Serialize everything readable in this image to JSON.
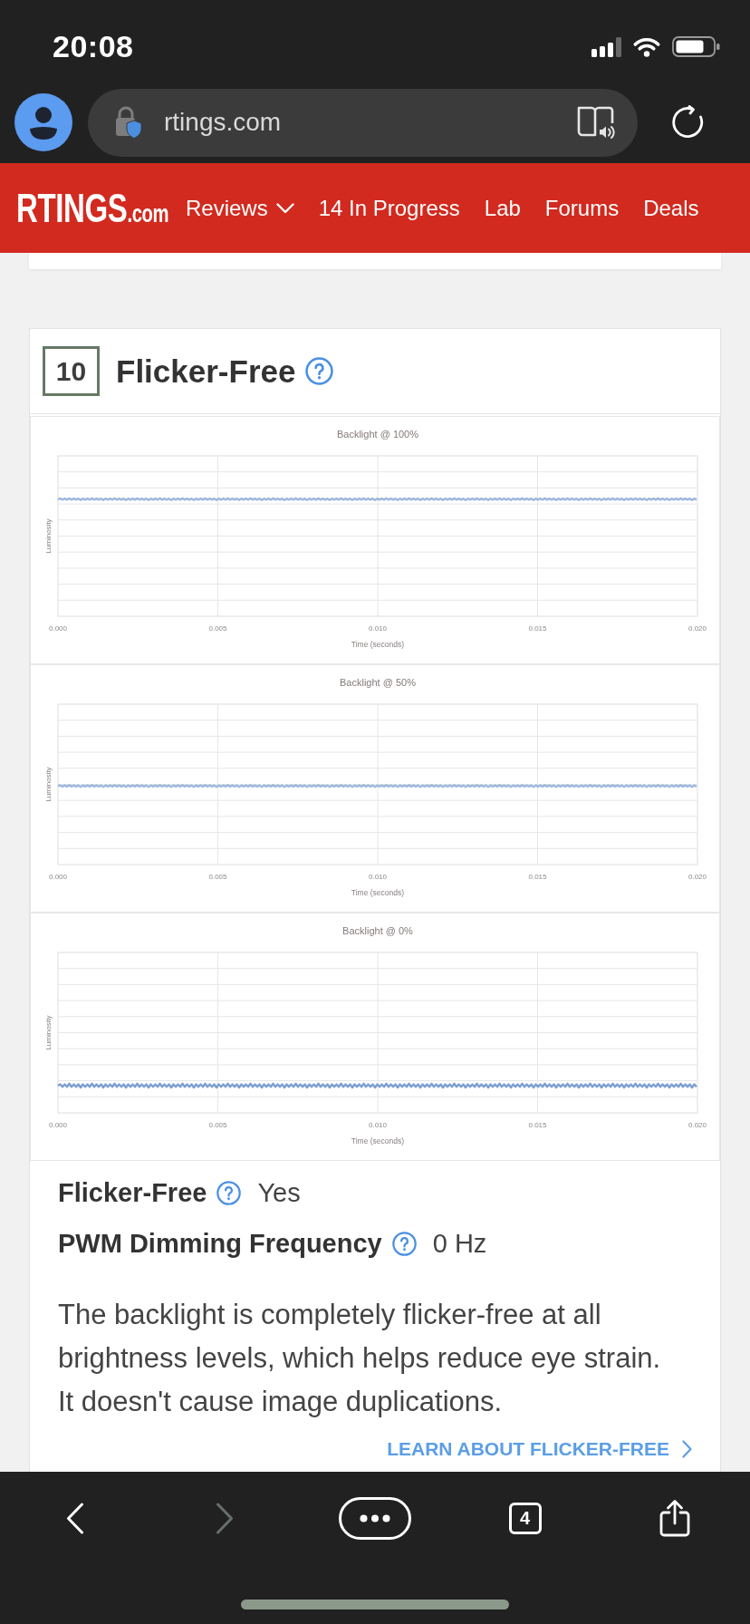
{
  "status_bar": {
    "time": "20:08"
  },
  "browser": {
    "url": "rtings.com"
  },
  "site_nav": {
    "logo": {
      "name": "RTINGS",
      "suffix": ".com"
    },
    "items": [
      {
        "label": "Reviews",
        "kind": "dropdown"
      },
      {
        "label": "14 In Progress",
        "kind": "link"
      },
      {
        "label": "Lab",
        "kind": "link"
      },
      {
        "label": "Forums",
        "kind": "link"
      },
      {
        "label": "Deals",
        "kind": "link"
      }
    ]
  },
  "section": {
    "score": "10",
    "title": "Flicker-Free",
    "charts": [
      {
        "title": "Backlight @ 100%",
        "xlabel": "Time (seconds)",
        "ylabel": "Luminosity",
        "xticks": [
          "0.000",
          "0.005",
          "0.010",
          "0.015",
          "0.020"
        ]
      },
      {
        "title": "Backlight @ 50%",
        "xlabel": "Time (seconds)",
        "ylabel": "Luminosity",
        "xticks": [
          "0.000",
          "0.005",
          "0.010",
          "0.015",
          "0.020"
        ]
      },
      {
        "title": "Backlight @ 0%",
        "xlabel": "Time (seconds)",
        "ylabel": "Luminosity",
        "xticks": [
          "0.000",
          "0.005",
          "0.010",
          "0.015",
          "0.020"
        ]
      }
    ],
    "results": [
      {
        "label": "Flicker-Free",
        "value": "Yes"
      },
      {
        "label": "PWM Dimming Frequency",
        "value": "0 Hz"
      }
    ],
    "description": "The backlight is completely flicker-free at all brightness levels, which helps reduce eye strain. It doesn't cause image duplications.",
    "link": "LEARN ABOUT FLICKER-FREE"
  },
  "toolbar": {
    "buttons": [
      {
        "kind": "back",
        "disabled": false
      },
      {
        "kind": "forward",
        "disabled": true
      },
      {
        "kind": "more",
        "disabled": false
      },
      {
        "kind": "tabs",
        "label": "4",
        "disabled": false
      },
      {
        "kind": "share",
        "disabled": false
      }
    ]
  }
}
